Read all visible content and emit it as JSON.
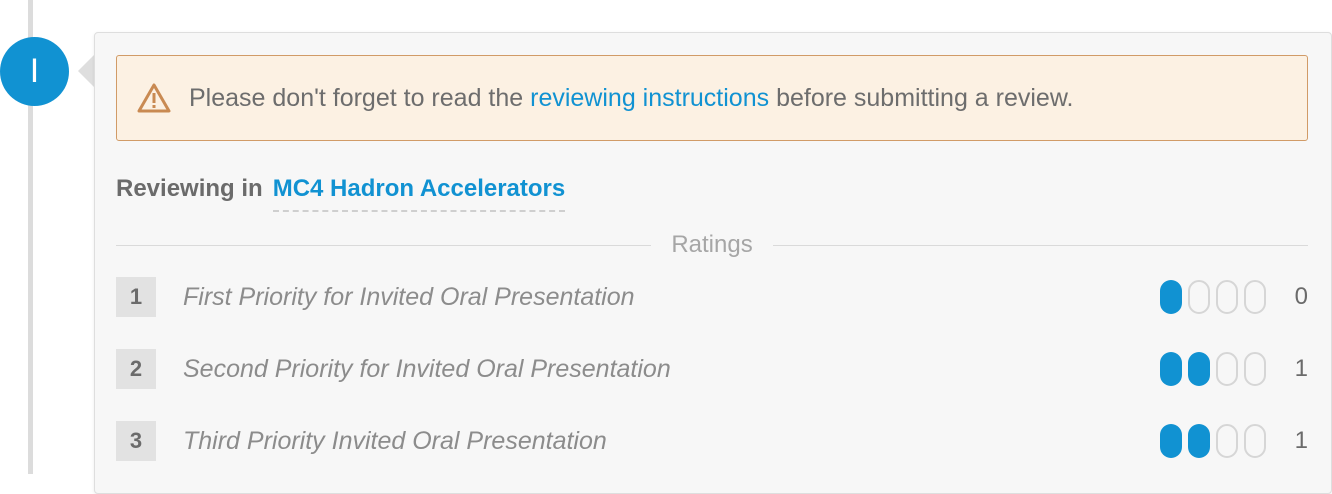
{
  "user": {
    "avatar_initial": "I"
  },
  "warning": {
    "text_before": "Please don't forget to read the ",
    "link_text": "reviewing instructions",
    "text_after": " before submitting a review.",
    "icon": "warning-triangle-icon"
  },
  "reviewing": {
    "label": "Reviewing in",
    "track": "MC4 Hadron Accelerators"
  },
  "ratings": {
    "heading": "Ratings",
    "items": [
      {
        "number": "1",
        "label": "First Priority for Invited Oral Presentation",
        "value": "0",
        "filled": 1,
        "total": 4
      },
      {
        "number": "2",
        "label": "Second Priority for Invited Oral Presentation",
        "value": "1",
        "filled": 2,
        "total": 4
      },
      {
        "number": "3",
        "label": "Third Priority Invited Oral Presentation",
        "value": "1",
        "filled": 2,
        "total": 4
      }
    ]
  },
  "colors": {
    "accent": "#1192d2",
    "warning_bg": "#fcf1e3",
    "warning_border": "#d19b67"
  }
}
